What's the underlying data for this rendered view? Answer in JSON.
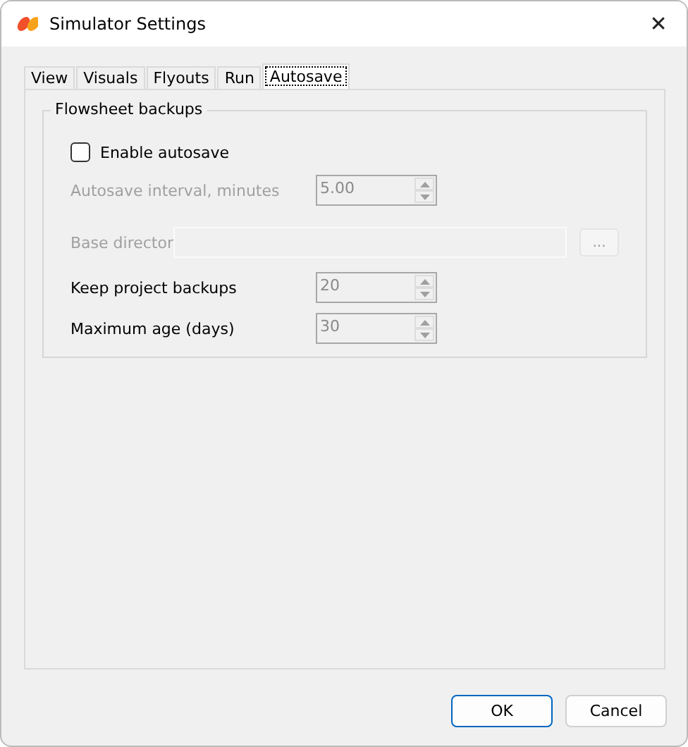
{
  "window": {
    "title": "Simulator Settings",
    "close": "✕"
  },
  "tabs": [
    {
      "label": "View",
      "selected": false
    },
    {
      "label": "Visuals",
      "selected": false
    },
    {
      "label": "Flyouts",
      "selected": false
    },
    {
      "label": "Run",
      "selected": false
    },
    {
      "label": "Autosave",
      "selected": true
    }
  ],
  "group": {
    "title": "Flowsheet backups",
    "checkbox": {
      "label": "Enable autosave",
      "checked": false
    },
    "rows": [
      {
        "kind": "spinner",
        "label": "Autosave interval, minutes",
        "value": "5.00",
        "disabled": true
      },
      {
        "kind": "path",
        "label": "Base director",
        "browse": "...",
        "disabled": true
      },
      {
        "kind": "spinner",
        "label": "Keep project backups",
        "value": "20",
        "disabled": false
      },
      {
        "kind": "spinner",
        "label": "Maximum age (days)",
        "value": "30",
        "disabled": false
      }
    ]
  },
  "buttons": [
    {
      "label": "OK",
      "default": true
    },
    {
      "label": "Cancel",
      "default": false
    }
  ]
}
